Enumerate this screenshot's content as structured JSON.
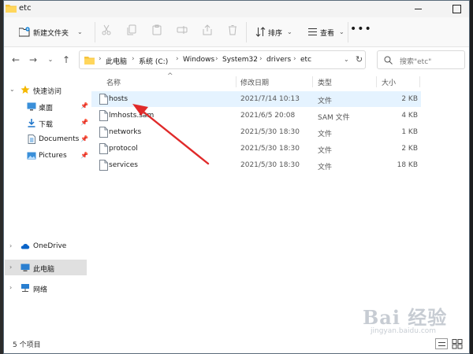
{
  "window": {
    "title": "etc"
  },
  "toolbar": {
    "new_folder_label": "新建文件夹",
    "sort_label": "排序",
    "view_label": "查看",
    "more_label": "•••"
  },
  "address": {
    "crumbs": [
      "此电脑",
      "系统 (C:)",
      "Windows",
      "System32",
      "drivers",
      "etc"
    ]
  },
  "search": {
    "placeholder": "搜索\"etc\""
  },
  "sidebar": {
    "items": [
      {
        "label": "快速访问"
      },
      {
        "label": "桌面"
      },
      {
        "label": "下载"
      },
      {
        "label": "Documents"
      },
      {
        "label": "Pictures"
      },
      {
        "label": "OneDrive"
      },
      {
        "label": "此电脑"
      },
      {
        "label": "网络"
      }
    ]
  },
  "columns": {
    "name": "名称",
    "modified": "修改日期",
    "type": "类型",
    "size": "大小"
  },
  "files": [
    {
      "name": "hosts",
      "modified": "2021/7/14 10:13",
      "type": "文件",
      "size": "2 KB"
    },
    {
      "name": "lmhosts.sam",
      "modified": "2021/6/5 20:08",
      "type": "SAM 文件",
      "size": "4 KB"
    },
    {
      "name": "networks",
      "modified": "2021/5/30 18:30",
      "type": "文件",
      "size": "1 KB"
    },
    {
      "name": "protocol",
      "modified": "2021/5/30 18:30",
      "type": "文件",
      "size": "2 KB"
    },
    {
      "name": "services",
      "modified": "2021/5/30 18:30",
      "type": "文件",
      "size": "18 KB"
    }
  ],
  "status": {
    "item_count": "5 个项目"
  },
  "watermark": {
    "brand": "Bai 经验",
    "url": "jingyan.baidu.com"
  },
  "colors": {
    "accent": "#0078d4",
    "selection": "#e5f3ff",
    "folder": "#f5c33b",
    "arrow": "#e02a2a"
  }
}
